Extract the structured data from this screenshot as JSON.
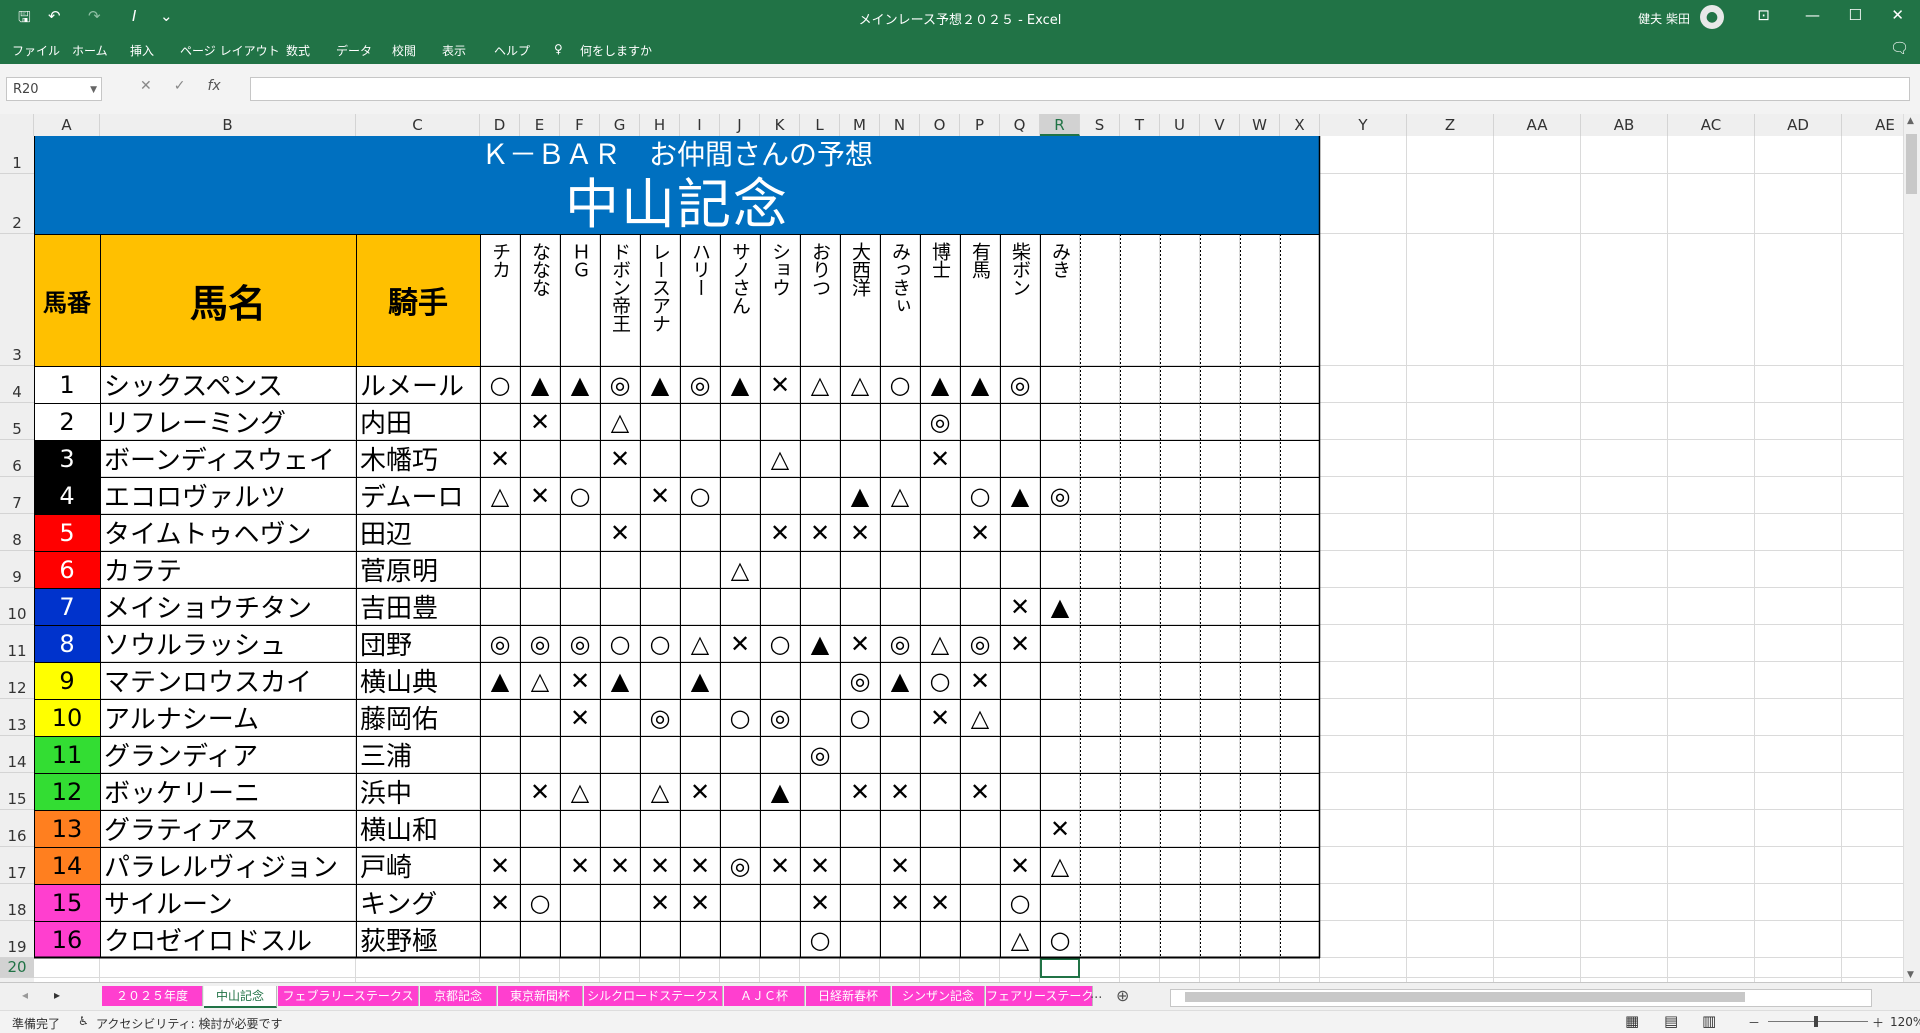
{
  "window": {
    "title": "メインレース予想２０２５ - Excel",
    "user": "健夫 柴田",
    "user_initial": "●",
    "qa_save": "🖫",
    "qa_undo": "↶",
    "qa_redo": "↷",
    "qa_cursor": "I",
    "qa_customize": "⌄",
    "min": "—",
    "max": "☐",
    "close": "✕",
    "ribbon_display": "⊡"
  },
  "ribbon": {
    "tabs": [
      "ファイル",
      "ホーム",
      "挿入",
      "ページ レイアウト",
      "数式",
      "データ",
      "校閲",
      "表示",
      "ヘルプ"
    ],
    "tellme_icon": "♀",
    "tellme": "何をしますか",
    "share": "🗨"
  },
  "formula_bar": {
    "name_box": "R20",
    "cancel": "✕",
    "enter": "✓",
    "fx": "fx",
    "value": ""
  },
  "columns": [
    "A",
    "B",
    "C",
    "D",
    "E",
    "F",
    "G",
    "H",
    "I",
    "J",
    "K",
    "L",
    "M",
    "N",
    "O",
    "P",
    "Q",
    "R",
    "S",
    "T",
    "U",
    "V",
    "W",
    "X",
    "Y",
    "Z",
    "AA",
    "AB",
    "AC",
    "AD",
    "AE"
  ],
  "row_numbers": [
    "1",
    "2",
    "3",
    "4",
    "5",
    "6",
    "7",
    "8",
    "9",
    "10",
    "11",
    "12",
    "13",
    "14",
    "15",
    "16",
    "17",
    "18",
    "19",
    "20"
  ],
  "sheet": {
    "banner_sub": "Ｋ－ＢＡＲ　お仲間さんの予想",
    "banner_title": "中山記念",
    "header_umaban": "馬番",
    "header_bamei": "馬名",
    "header_kishu": "騎手",
    "predictors": [
      "チカ",
      "ななな",
      "ＨＧ",
      "ドボン帝王",
      "レースアナ",
      "ハリー",
      "サノさん",
      "ショウ",
      "おりつ",
      "大西洋",
      "みっきぃ",
      "博士",
      "有馬",
      "柴ボン",
      "みき"
    ],
    "horses": [
      {
        "no": "1",
        "name": "シックスペンス",
        "jockey": "ルメール",
        "bg": "#ffffff",
        "fg": "#000000",
        "marks": [
          "○",
          "▲",
          "▲",
          "◎",
          "▲",
          "◎",
          "▲",
          "✕",
          "△",
          "△",
          "○",
          "▲",
          "▲",
          "◎",
          ""
        ]
      },
      {
        "no": "2",
        "name": "リフレーミング",
        "jockey": "内田",
        "bg": "#ffffff",
        "fg": "#000000",
        "marks": [
          "",
          "✕",
          "",
          "△",
          "",
          "",
          "",
          "",
          "",
          "",
          "",
          "◎",
          "",
          "",
          ""
        ]
      },
      {
        "no": "3",
        "name": "ボーンディスウェイ",
        "jockey": "木幡巧",
        "bg": "#000000",
        "fg": "#ffffff",
        "marks": [
          "✕",
          "",
          "",
          "✕",
          "",
          "",
          "",
          "△",
          "",
          "",
          "",
          "✕",
          "",
          "",
          ""
        ]
      },
      {
        "no": "4",
        "name": "エコロヴァルツ",
        "jockey": "デムーロ",
        "bg": "#000000",
        "fg": "#ffffff",
        "marks": [
          "△",
          "✕",
          "○",
          "",
          "✕",
          "○",
          "",
          "",
          "",
          "▲",
          "△",
          "",
          "○",
          "▲",
          "◎"
        ]
      },
      {
        "no": "5",
        "name": "タイムトゥヘヴン",
        "jockey": "田辺",
        "bg": "#ff0000",
        "fg": "#ffffff",
        "marks": [
          "",
          "",
          "",
          "✕",
          "",
          "",
          "",
          "✕",
          "✕",
          "✕",
          "",
          "",
          "✕",
          "",
          ""
        ]
      },
      {
        "no": "6",
        "name": "カラテ",
        "jockey": "菅原明",
        "bg": "#ff0000",
        "fg": "#ffffff",
        "marks": [
          "",
          "",
          "",
          "",
          "",
          "",
          "△",
          "",
          "",
          "",
          "",
          "",
          "",
          "",
          ""
        ]
      },
      {
        "no": "7",
        "name": "メイショウチタン",
        "jockey": "吉田豊",
        "bg": "#0033cc",
        "fg": "#ffffff",
        "marks": [
          "",
          "",
          "",
          "",
          "",
          "",
          "",
          "",
          "",
          "",
          "",
          "",
          "",
          "✕",
          "▲"
        ]
      },
      {
        "no": "8",
        "name": "ソウルラッシュ",
        "jockey": "団野",
        "bg": "#0033cc",
        "fg": "#ffffff",
        "marks": [
          "◎",
          "◎",
          "◎",
          "○",
          "○",
          "△",
          "✕",
          "○",
          "▲",
          "✕",
          "◎",
          "△",
          "◎",
          "✕",
          ""
        ]
      },
      {
        "no": "9",
        "name": "マテンロウスカイ",
        "jockey": "横山典",
        "bg": "#ffff00",
        "fg": "#000000",
        "marks": [
          "▲",
          "△",
          "✕",
          "▲",
          "",
          "▲",
          "",
          "",
          "",
          "◎",
          "▲",
          "○",
          "✕",
          "",
          ""
        ]
      },
      {
        "no": "10",
        "name": "アルナシーム",
        "jockey": "藤岡佑",
        "bg": "#ffff00",
        "fg": "#000000",
        "marks": [
          "",
          "",
          "✕",
          "",
          "◎",
          "",
          "○",
          "◎",
          "",
          "○",
          "",
          "✕",
          "△",
          "",
          ""
        ]
      },
      {
        "no": "11",
        "name": "グランディア",
        "jockey": "三浦",
        "bg": "#33dd33",
        "fg": "#000000",
        "marks": [
          "",
          "",
          "",
          "",
          "",
          "",
          "",
          "",
          "◎",
          "",
          "",
          "",
          "",
          "",
          ""
        ]
      },
      {
        "no": "12",
        "name": "ボッケリーニ",
        "jockey": "浜中",
        "bg": "#33dd33",
        "fg": "#000000",
        "marks": [
          "",
          "✕",
          "△",
          "",
          "△",
          "✕",
          "",
          "▲",
          "",
          "✕",
          "✕",
          "",
          "✕",
          "",
          ""
        ]
      },
      {
        "no": "13",
        "name": "グラティアス",
        "jockey": "横山和",
        "bg": "#ff7f1f",
        "fg": "#000000",
        "marks": [
          "",
          "",
          "",
          "",
          "",
          "",
          "",
          "",
          "",
          "",
          "",
          "",
          "",
          "",
          "✕"
        ]
      },
      {
        "no": "14",
        "name": "パラレルヴィジョン",
        "jockey": "戸崎",
        "bg": "#ff7f1f",
        "fg": "#000000",
        "marks": [
          "✕",
          "",
          "✕",
          "✕",
          "✕",
          "✕",
          "◎",
          "✕",
          "✕",
          "",
          "✕",
          "",
          "",
          "✕",
          "△"
        ]
      },
      {
        "no": "15",
        "name": "サイルーン",
        "jockey": "キング",
        "bg": "#ff3fcf",
        "fg": "#000000",
        "marks": [
          "✕",
          "○",
          "",
          "",
          "✕",
          "✕",
          "",
          "",
          "✕",
          "",
          "✕",
          "✕",
          "",
          "○",
          ""
        ]
      },
      {
        "no": "16",
        "name": "クロゼイロドスル",
        "jockey": "荻野極",
        "bg": "#ff3fcf",
        "fg": "#000000",
        "marks": [
          "",
          "",
          "",
          "",
          "",
          "",
          "",
          "",
          "○",
          "",
          "",
          "",
          "",
          "△",
          "○"
        ]
      }
    ]
  },
  "sheet_tabs": [
    "２０２５年度",
    "中山記念",
    "フェブラリーステークス",
    "京都記念",
    "東京新聞杯",
    "シルクロードステークス",
    "ＡＪＣ杯",
    "日経新春杯",
    "シンザン記念",
    "フェアリーステークス"
  ],
  "sheet_tabs_active": 1,
  "tab_nav": {
    "prev": "◂",
    "next": "▸",
    "more": "...",
    "add": "⊕"
  },
  "status": {
    "ready": "準備完了",
    "accessibility_icon": "♿",
    "accessibility": "アクセシビリティ: 検討が必要です",
    "view_normal": "▦",
    "view_layout": "▤",
    "view_break": "▥",
    "zoom_minus": "－",
    "zoom_plus": "＋",
    "zoom": "120%"
  }
}
